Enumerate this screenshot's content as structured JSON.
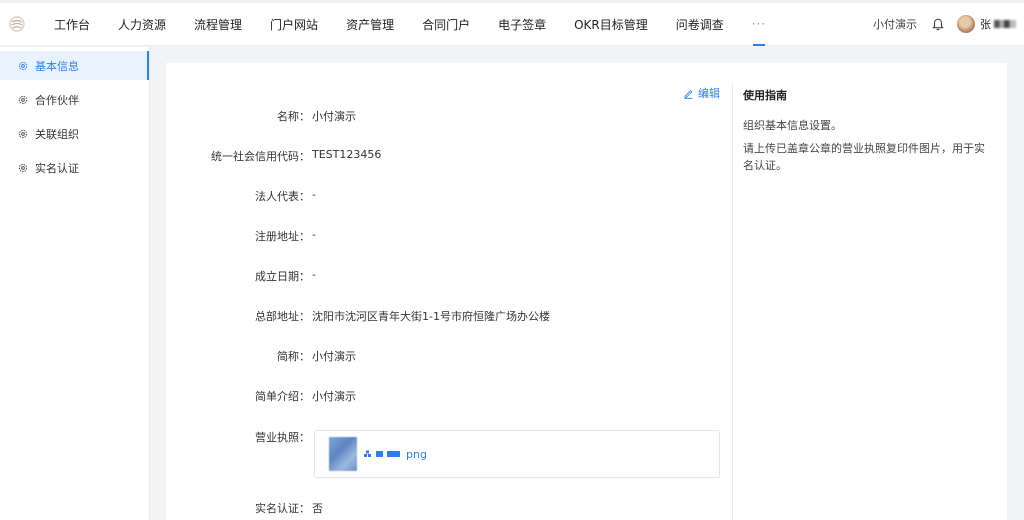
{
  "nav": {
    "items": [
      "工作台",
      "人力资源",
      "流程管理",
      "门户网站",
      "资产管理",
      "合同门户",
      "电子签章",
      "OKR目标管理",
      "问卷调查"
    ],
    "more": "···"
  },
  "header": {
    "org_name": "小付演示",
    "user_name": "张"
  },
  "sidebar": {
    "items": [
      {
        "label": "基本信息",
        "active": true
      },
      {
        "label": "合作伙伴",
        "active": false
      },
      {
        "label": "关联组织",
        "active": false
      },
      {
        "label": "实名认证",
        "active": false
      }
    ]
  },
  "form": {
    "edit_label": "编辑",
    "fields": [
      {
        "label": "名称：",
        "value": "小付演示"
      },
      {
        "label": "统一社会信用代码：",
        "value": "TEST123456"
      },
      {
        "label": "法人代表：",
        "value": "-"
      },
      {
        "label": "注册地址：",
        "value": "-"
      },
      {
        "label": "成立日期：",
        "value": "-"
      },
      {
        "label": "总部地址：",
        "value": "沈阳市沈河区青年大街1-1号市府恒隆广场办公楼"
      },
      {
        "label": "简称：",
        "value": "小付演示"
      },
      {
        "label": "简单介绍：",
        "value": "小付演示"
      },
      {
        "label": "营业执照：",
        "value": ""
      },
      {
        "label": "实名认证：",
        "value": "否"
      }
    ],
    "license_file_ext": "png"
  },
  "guide": {
    "title": "使用指南",
    "p1": "组织基本信息设置。",
    "p2": "请上传已盖章公章的营业执照复印件图片，用于实名认证。"
  },
  "colors": {
    "accent": "#2f7ef0",
    "active_bg": "#e9f3fe"
  }
}
